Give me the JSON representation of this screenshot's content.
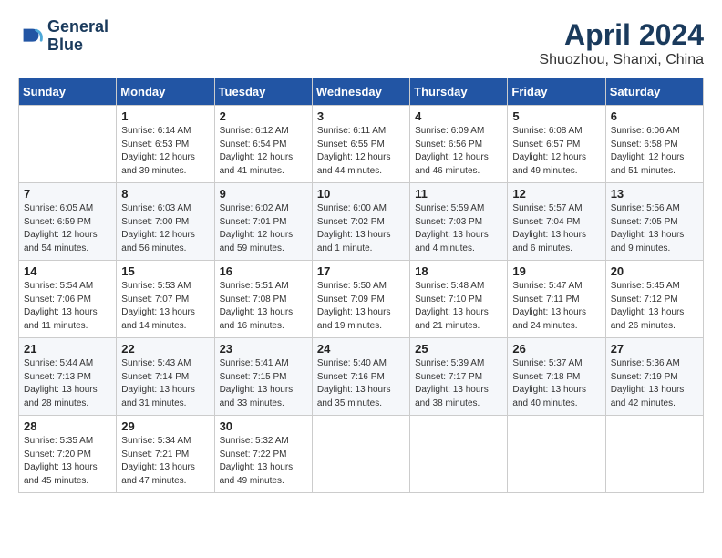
{
  "header": {
    "logo_line1": "General",
    "logo_line2": "Blue",
    "month": "April 2024",
    "location": "Shuozhou, Shanxi, China"
  },
  "days_of_week": [
    "Sunday",
    "Monday",
    "Tuesday",
    "Wednesday",
    "Thursday",
    "Friday",
    "Saturday"
  ],
  "weeks": [
    [
      {
        "day": "",
        "content": ""
      },
      {
        "day": "1",
        "content": "Sunrise: 6:14 AM\nSunset: 6:53 PM\nDaylight: 12 hours\nand 39 minutes."
      },
      {
        "day": "2",
        "content": "Sunrise: 6:12 AM\nSunset: 6:54 PM\nDaylight: 12 hours\nand 41 minutes."
      },
      {
        "day": "3",
        "content": "Sunrise: 6:11 AM\nSunset: 6:55 PM\nDaylight: 12 hours\nand 44 minutes."
      },
      {
        "day": "4",
        "content": "Sunrise: 6:09 AM\nSunset: 6:56 PM\nDaylight: 12 hours\nand 46 minutes."
      },
      {
        "day": "5",
        "content": "Sunrise: 6:08 AM\nSunset: 6:57 PM\nDaylight: 12 hours\nand 49 minutes."
      },
      {
        "day": "6",
        "content": "Sunrise: 6:06 AM\nSunset: 6:58 PM\nDaylight: 12 hours\nand 51 minutes."
      }
    ],
    [
      {
        "day": "7",
        "content": "Sunrise: 6:05 AM\nSunset: 6:59 PM\nDaylight: 12 hours\nand 54 minutes."
      },
      {
        "day": "8",
        "content": "Sunrise: 6:03 AM\nSunset: 7:00 PM\nDaylight: 12 hours\nand 56 minutes."
      },
      {
        "day": "9",
        "content": "Sunrise: 6:02 AM\nSunset: 7:01 PM\nDaylight: 12 hours\nand 59 minutes."
      },
      {
        "day": "10",
        "content": "Sunrise: 6:00 AM\nSunset: 7:02 PM\nDaylight: 13 hours\nand 1 minute."
      },
      {
        "day": "11",
        "content": "Sunrise: 5:59 AM\nSunset: 7:03 PM\nDaylight: 13 hours\nand 4 minutes."
      },
      {
        "day": "12",
        "content": "Sunrise: 5:57 AM\nSunset: 7:04 PM\nDaylight: 13 hours\nand 6 minutes."
      },
      {
        "day": "13",
        "content": "Sunrise: 5:56 AM\nSunset: 7:05 PM\nDaylight: 13 hours\nand 9 minutes."
      }
    ],
    [
      {
        "day": "14",
        "content": "Sunrise: 5:54 AM\nSunset: 7:06 PM\nDaylight: 13 hours\nand 11 minutes."
      },
      {
        "day": "15",
        "content": "Sunrise: 5:53 AM\nSunset: 7:07 PM\nDaylight: 13 hours\nand 14 minutes."
      },
      {
        "day": "16",
        "content": "Sunrise: 5:51 AM\nSunset: 7:08 PM\nDaylight: 13 hours\nand 16 minutes."
      },
      {
        "day": "17",
        "content": "Sunrise: 5:50 AM\nSunset: 7:09 PM\nDaylight: 13 hours\nand 19 minutes."
      },
      {
        "day": "18",
        "content": "Sunrise: 5:48 AM\nSunset: 7:10 PM\nDaylight: 13 hours\nand 21 minutes."
      },
      {
        "day": "19",
        "content": "Sunrise: 5:47 AM\nSunset: 7:11 PM\nDaylight: 13 hours\nand 24 minutes."
      },
      {
        "day": "20",
        "content": "Sunrise: 5:45 AM\nSunset: 7:12 PM\nDaylight: 13 hours\nand 26 minutes."
      }
    ],
    [
      {
        "day": "21",
        "content": "Sunrise: 5:44 AM\nSunset: 7:13 PM\nDaylight: 13 hours\nand 28 minutes."
      },
      {
        "day": "22",
        "content": "Sunrise: 5:43 AM\nSunset: 7:14 PM\nDaylight: 13 hours\nand 31 minutes."
      },
      {
        "day": "23",
        "content": "Sunrise: 5:41 AM\nSunset: 7:15 PM\nDaylight: 13 hours\nand 33 minutes."
      },
      {
        "day": "24",
        "content": "Sunrise: 5:40 AM\nSunset: 7:16 PM\nDaylight: 13 hours\nand 35 minutes."
      },
      {
        "day": "25",
        "content": "Sunrise: 5:39 AM\nSunset: 7:17 PM\nDaylight: 13 hours\nand 38 minutes."
      },
      {
        "day": "26",
        "content": "Sunrise: 5:37 AM\nSunset: 7:18 PM\nDaylight: 13 hours\nand 40 minutes."
      },
      {
        "day": "27",
        "content": "Sunrise: 5:36 AM\nSunset: 7:19 PM\nDaylight: 13 hours\nand 42 minutes."
      }
    ],
    [
      {
        "day": "28",
        "content": "Sunrise: 5:35 AM\nSunset: 7:20 PM\nDaylight: 13 hours\nand 45 minutes."
      },
      {
        "day": "29",
        "content": "Sunrise: 5:34 AM\nSunset: 7:21 PM\nDaylight: 13 hours\nand 47 minutes."
      },
      {
        "day": "30",
        "content": "Sunrise: 5:32 AM\nSunset: 7:22 PM\nDaylight: 13 hours\nand 49 minutes."
      },
      {
        "day": "",
        "content": ""
      },
      {
        "day": "",
        "content": ""
      },
      {
        "day": "",
        "content": ""
      },
      {
        "day": "",
        "content": ""
      }
    ]
  ]
}
